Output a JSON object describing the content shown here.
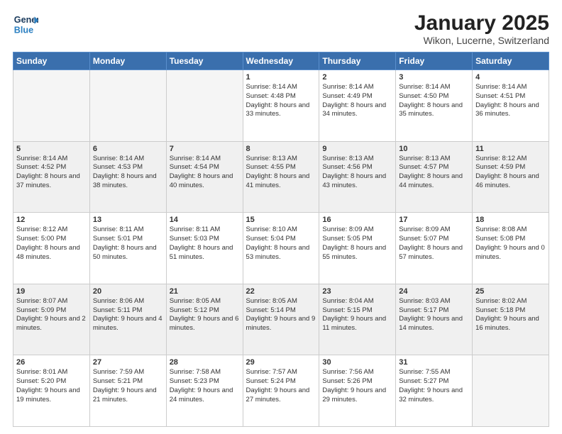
{
  "logo": {
    "line1": "General",
    "line2": "Blue",
    "icon": "▶"
  },
  "header": {
    "title": "January 2025",
    "subtitle": "Wikon, Lucerne, Switzerland"
  },
  "weekdays": [
    "Sunday",
    "Monday",
    "Tuesday",
    "Wednesday",
    "Thursday",
    "Friday",
    "Saturday"
  ],
  "weeks": [
    [
      {
        "day": "",
        "empty": true
      },
      {
        "day": "",
        "empty": true
      },
      {
        "day": "",
        "empty": true
      },
      {
        "day": "1",
        "sunrise": "8:14 AM",
        "sunset": "4:48 PM",
        "daylight": "8 hours and 33 minutes."
      },
      {
        "day": "2",
        "sunrise": "8:14 AM",
        "sunset": "4:49 PM",
        "daylight": "8 hours and 34 minutes."
      },
      {
        "day": "3",
        "sunrise": "8:14 AM",
        "sunset": "4:50 PM",
        "daylight": "8 hours and 35 minutes."
      },
      {
        "day": "4",
        "sunrise": "8:14 AM",
        "sunset": "4:51 PM",
        "daylight": "8 hours and 36 minutes."
      }
    ],
    [
      {
        "day": "5",
        "sunrise": "8:14 AM",
        "sunset": "4:52 PM",
        "daylight": "8 hours and 37 minutes."
      },
      {
        "day": "6",
        "sunrise": "8:14 AM",
        "sunset": "4:53 PM",
        "daylight": "8 hours and 38 minutes."
      },
      {
        "day": "7",
        "sunrise": "8:14 AM",
        "sunset": "4:54 PM",
        "daylight": "8 hours and 40 minutes."
      },
      {
        "day": "8",
        "sunrise": "8:13 AM",
        "sunset": "4:55 PM",
        "daylight": "8 hours and 41 minutes."
      },
      {
        "day": "9",
        "sunrise": "8:13 AM",
        "sunset": "4:56 PM",
        "daylight": "8 hours and 43 minutes."
      },
      {
        "day": "10",
        "sunrise": "8:13 AM",
        "sunset": "4:57 PM",
        "daylight": "8 hours and 44 minutes."
      },
      {
        "day": "11",
        "sunrise": "8:12 AM",
        "sunset": "4:59 PM",
        "daylight": "8 hours and 46 minutes."
      }
    ],
    [
      {
        "day": "12",
        "sunrise": "8:12 AM",
        "sunset": "5:00 PM",
        "daylight": "8 hours and 48 minutes."
      },
      {
        "day": "13",
        "sunrise": "8:11 AM",
        "sunset": "5:01 PM",
        "daylight": "8 hours and 50 minutes."
      },
      {
        "day": "14",
        "sunrise": "8:11 AM",
        "sunset": "5:03 PM",
        "daylight": "8 hours and 51 minutes."
      },
      {
        "day": "15",
        "sunrise": "8:10 AM",
        "sunset": "5:04 PM",
        "daylight": "8 hours and 53 minutes."
      },
      {
        "day": "16",
        "sunrise": "8:09 AM",
        "sunset": "5:05 PM",
        "daylight": "8 hours and 55 minutes."
      },
      {
        "day": "17",
        "sunrise": "8:09 AM",
        "sunset": "5:07 PM",
        "daylight": "8 hours and 57 minutes."
      },
      {
        "day": "18",
        "sunrise": "8:08 AM",
        "sunset": "5:08 PM",
        "daylight": "9 hours and 0 minutes."
      }
    ],
    [
      {
        "day": "19",
        "sunrise": "8:07 AM",
        "sunset": "5:09 PM",
        "daylight": "9 hours and 2 minutes."
      },
      {
        "day": "20",
        "sunrise": "8:06 AM",
        "sunset": "5:11 PM",
        "daylight": "9 hours and 4 minutes."
      },
      {
        "day": "21",
        "sunrise": "8:05 AM",
        "sunset": "5:12 PM",
        "daylight": "9 hours and 6 minutes."
      },
      {
        "day": "22",
        "sunrise": "8:05 AM",
        "sunset": "5:14 PM",
        "daylight": "9 hours and 9 minutes."
      },
      {
        "day": "23",
        "sunrise": "8:04 AM",
        "sunset": "5:15 PM",
        "daylight": "9 hours and 11 minutes."
      },
      {
        "day": "24",
        "sunrise": "8:03 AM",
        "sunset": "5:17 PM",
        "daylight": "9 hours and 14 minutes."
      },
      {
        "day": "25",
        "sunrise": "8:02 AM",
        "sunset": "5:18 PM",
        "daylight": "9 hours and 16 minutes."
      }
    ],
    [
      {
        "day": "26",
        "sunrise": "8:01 AM",
        "sunset": "5:20 PM",
        "daylight": "9 hours and 19 minutes."
      },
      {
        "day": "27",
        "sunrise": "7:59 AM",
        "sunset": "5:21 PM",
        "daylight": "9 hours and 21 minutes."
      },
      {
        "day": "28",
        "sunrise": "7:58 AM",
        "sunset": "5:23 PM",
        "daylight": "9 hours and 24 minutes."
      },
      {
        "day": "29",
        "sunrise": "7:57 AM",
        "sunset": "5:24 PM",
        "daylight": "9 hours and 27 minutes."
      },
      {
        "day": "30",
        "sunrise": "7:56 AM",
        "sunset": "5:26 PM",
        "daylight": "9 hours and 29 minutes."
      },
      {
        "day": "31",
        "sunrise": "7:55 AM",
        "sunset": "5:27 PM",
        "daylight": "9 hours and 32 minutes."
      },
      {
        "day": "",
        "empty": true
      }
    ]
  ]
}
